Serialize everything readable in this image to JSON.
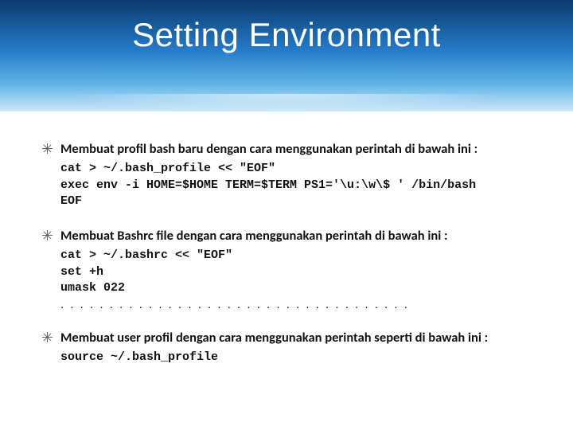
{
  "title": "Setting Environment",
  "bullets": [
    {
      "lead": "Membuat profil bash baru dengan cara menggunakan perintah di bawah ini :",
      "code": "cat > ~/.bash_profile << \"EOF\"\nexec env -i HOME=$HOME TERM=$TERM PS1='\\u:\\w\\$ ' /bin/bash\nEOF",
      "dots": ""
    },
    {
      "lead": "Membuat Bashrc file dengan cara menggunakan perintah di bawah ini :",
      "code": "cat > ~/.bashrc << \"EOF\"\nset +h\numask 022",
      "dots": ". . . . . . . . . . . . . . . . . . . . . . . . . . . . . . . . . . . ."
    },
    {
      "lead": "Membuat user profil dengan cara menggunakan perintah seperti di bawah ini :",
      "code": "source ~/.bash_profile",
      "dots": ""
    }
  ]
}
